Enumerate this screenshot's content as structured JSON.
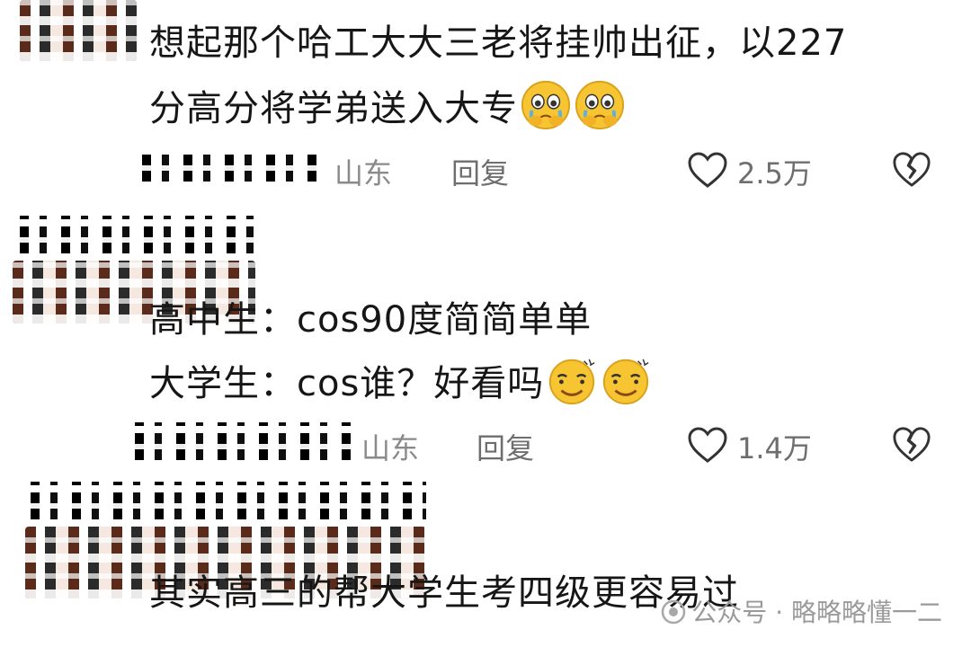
{
  "comments": [
    {
      "text_line1": "想起那个哈工大大三老将挂帅出征，以227",
      "text_line2": "分高分将学弟送入大专",
      "emoji": "crying-face",
      "location": "山东",
      "reply_label": "回复",
      "likes": "2.5万"
    },
    {
      "text_line1": "高中生：cos90度简简单单",
      "text_line2": "大学生：cos谁？好看吗",
      "emoji": "dizzy-smile-face",
      "location": "山东",
      "reply_label": "回复",
      "likes": "1.4万"
    },
    {
      "text_line1": "其实高三的帮大学生考四级更容易过"
    }
  ],
  "watermark": "公众号 · 略略略懂一二",
  "icons": {
    "like": "heart-outline-icon",
    "dislike": "broken-heart-icon"
  },
  "colors": {
    "text": "#161616",
    "meta": "#8a8a8a",
    "emoji_yellow": "#f7c531"
  }
}
